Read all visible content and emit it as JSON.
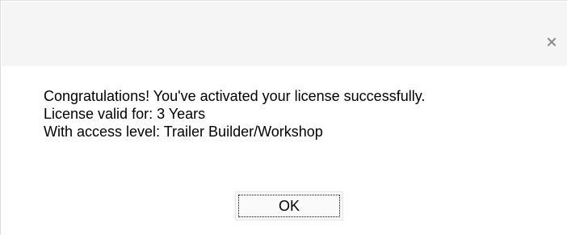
{
  "dialog": {
    "close_icon": "close-icon",
    "message_lines": [
      "Congratulations! You've activated your license successfully.",
      "License valid for: 3 Years",
      "With access level: Trailer Builder/Workshop"
    ],
    "ok_label": "OK"
  },
  "colors": {
    "title_bar_bg": "#f5f5f5",
    "close_icon": "#8a8a8a"
  }
}
